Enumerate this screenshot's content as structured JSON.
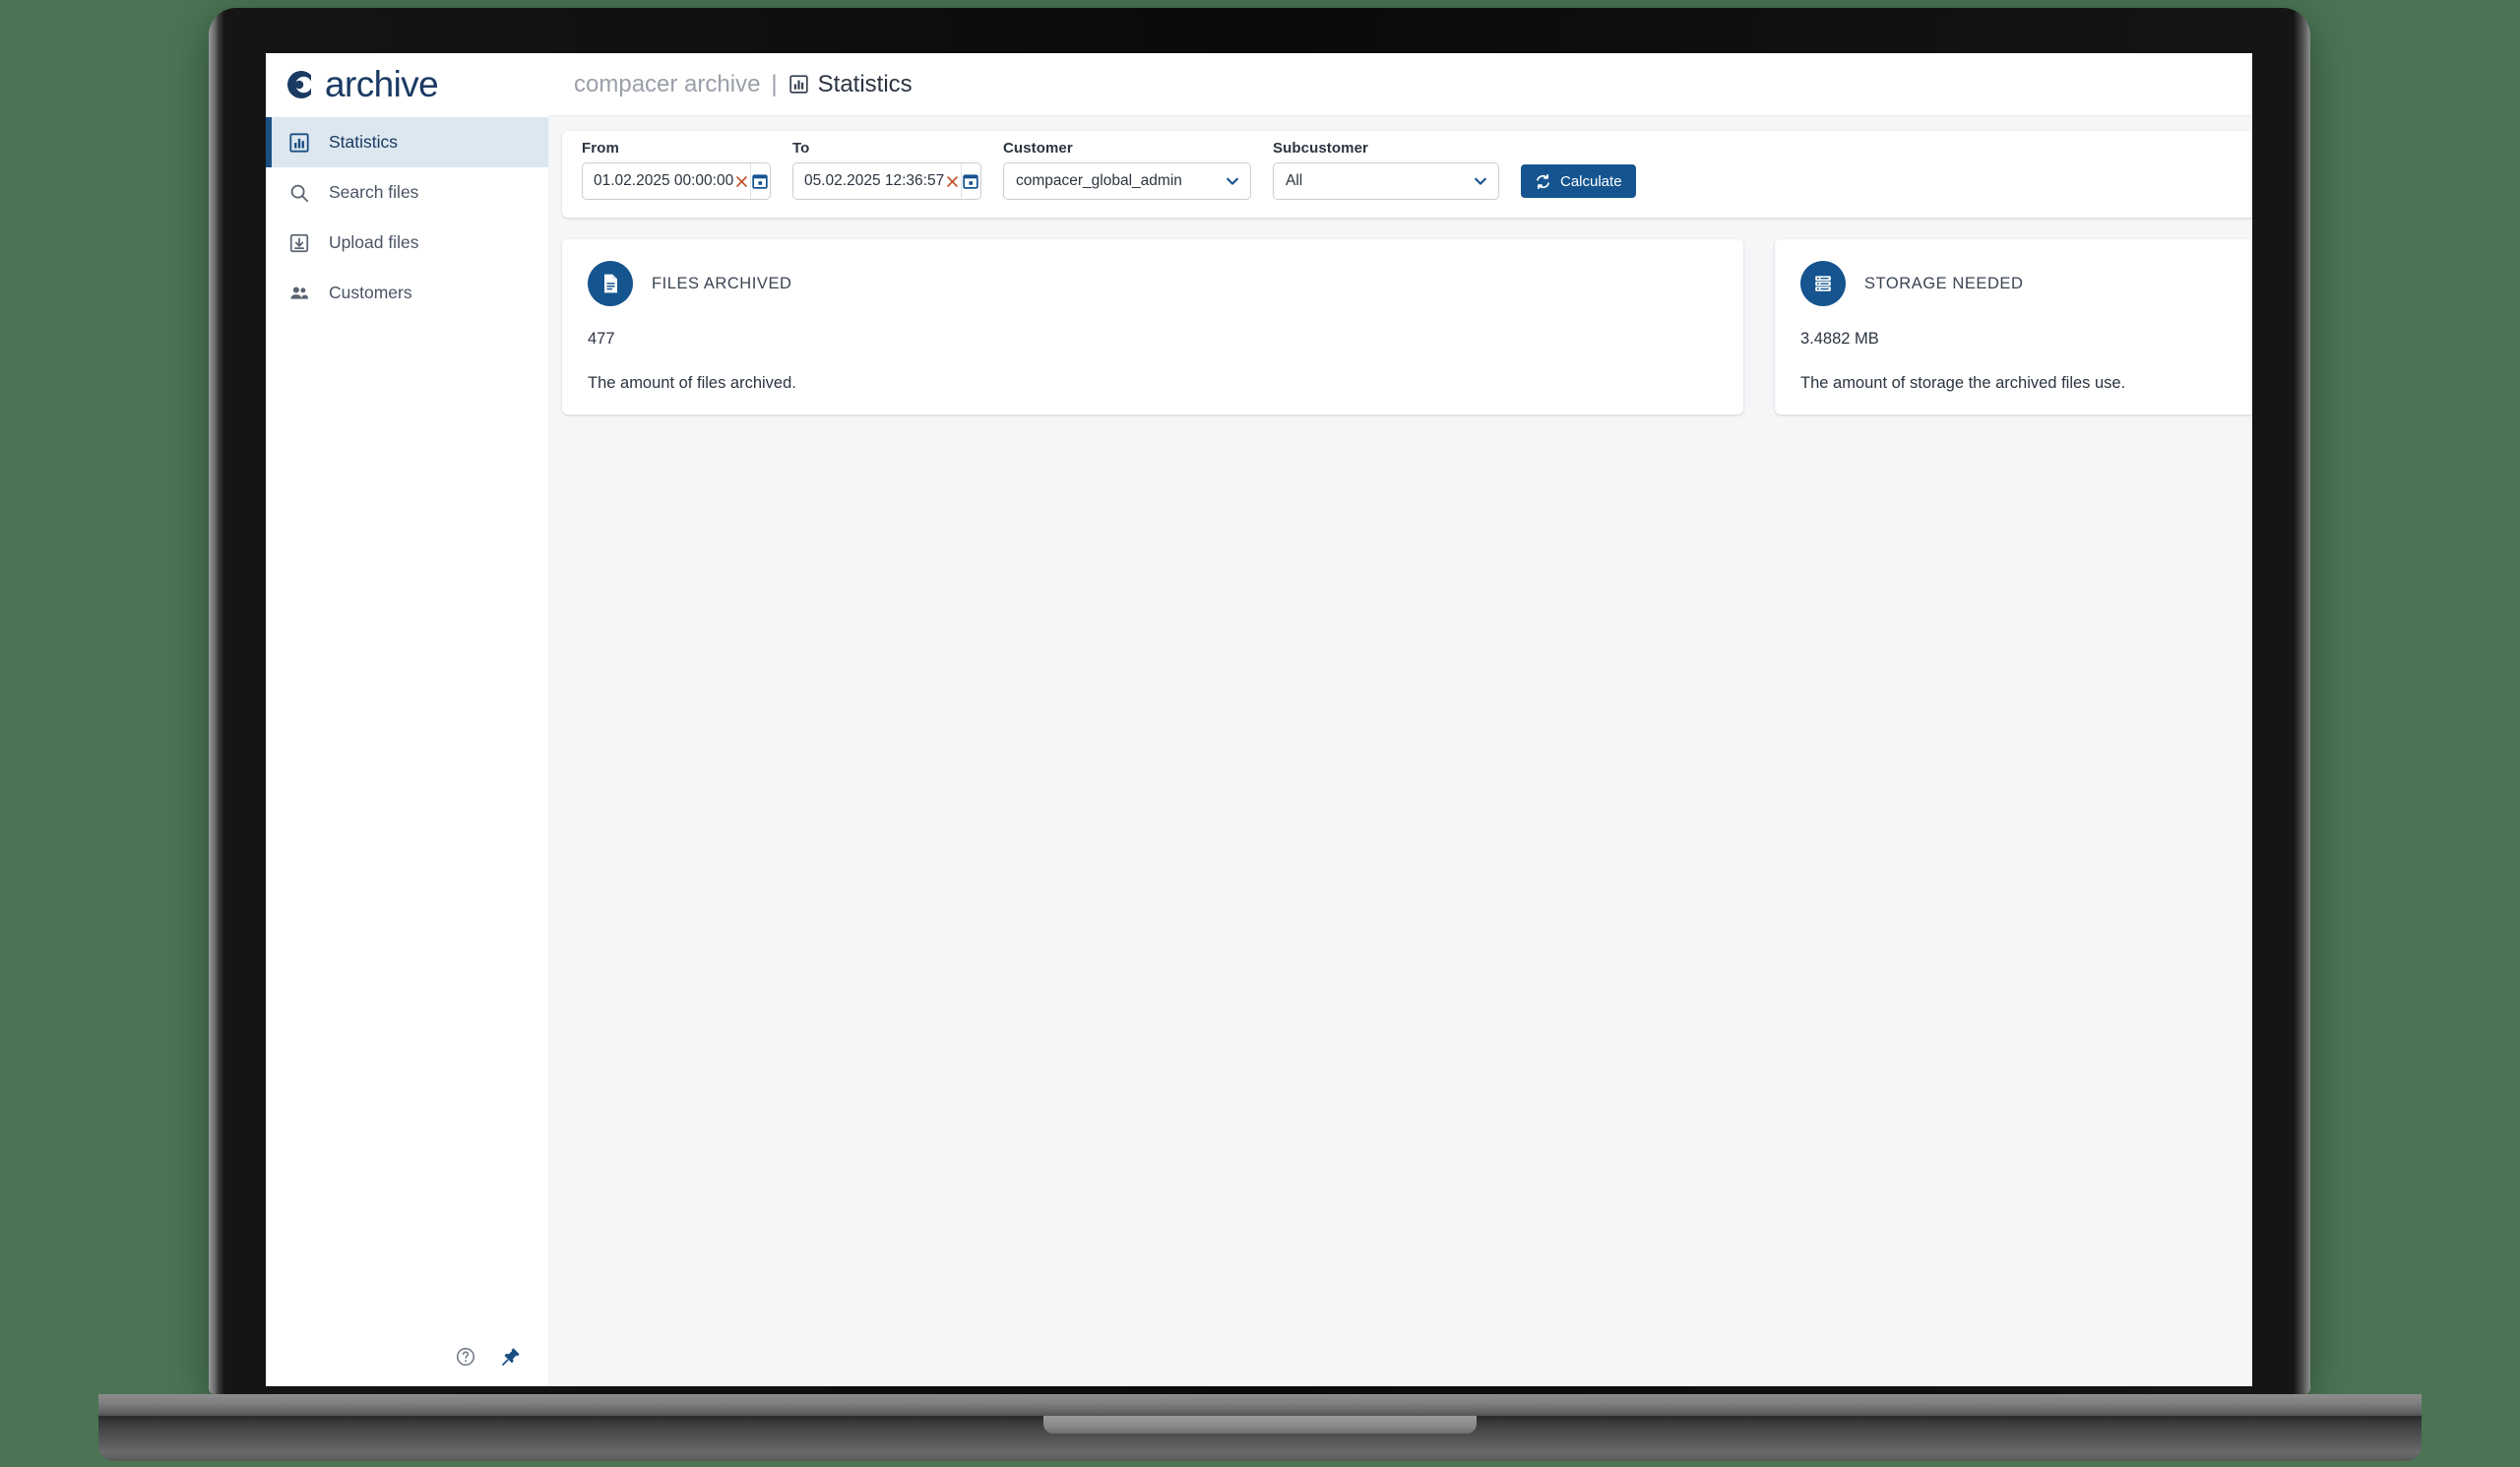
{
  "brand": {
    "logo_icon": "archive-circle-logo-icon",
    "name": "archive"
  },
  "sidebar": {
    "items": [
      {
        "label": "Statistics",
        "icon": "bar-chart-icon",
        "active": true
      },
      {
        "label": "Search files",
        "icon": "search-icon",
        "active": false
      },
      {
        "label": "Upload files",
        "icon": "upload-box-icon",
        "active": false
      },
      {
        "label": "Customers",
        "icon": "people-icon",
        "active": false
      }
    ],
    "footer": {
      "help_icon": "help-circle-icon",
      "pin_icon": "pin-icon"
    }
  },
  "topbar": {
    "app_name": "compacer archive",
    "separator": "|",
    "page_icon": "bar-chart-icon",
    "page_title": "Statistics"
  },
  "filters": {
    "from": {
      "label": "From",
      "value": "01.02.2025 00:00:00",
      "clear_icon": "close-x-icon",
      "calendar_icon": "calendar-icon"
    },
    "to": {
      "label": "To",
      "value": "05.02.2025 12:36:57",
      "clear_icon": "close-x-icon",
      "calendar_icon": "calendar-icon"
    },
    "customer": {
      "label": "Customer",
      "value": "compacer_global_admin",
      "chevron_icon": "chevron-down-icon"
    },
    "subcustomer": {
      "label": "Subcustomer",
      "value": "All",
      "chevron_icon": "chevron-down-icon"
    },
    "calculate": {
      "label": "Calculate",
      "icon": "refresh-sync-icon"
    }
  },
  "cards": [
    {
      "icon": "document-file-icon",
      "title": "FILES ARCHIVED",
      "value": "477",
      "description": "The amount of files archived."
    },
    {
      "icon": "storage-server-icon",
      "title": "STORAGE NEEDED",
      "value": "3.4882 MB",
      "description": "The amount of storage the archived files use."
    }
  ],
  "colors": {
    "brand_blue": "#1b3a63",
    "accent_blue": "#15548f",
    "active_nav_bg": "#dde7ef",
    "active_nav_bar": "#1b4f84",
    "page_bg": "#f4f6f8",
    "clear_x": "#c0522a",
    "desktop_bg": "#4a7453"
  }
}
